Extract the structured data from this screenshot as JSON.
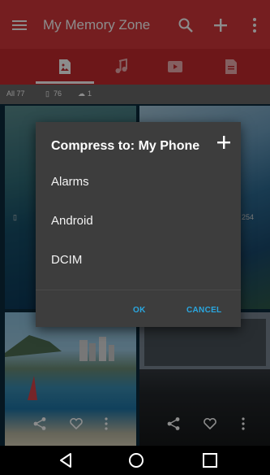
{
  "appbar": {
    "title": "My Memory Zone",
    "color": "#d6373b"
  },
  "icons": {
    "menu": "hamburger-menu-icon",
    "search": "search-icon",
    "add": "add-icon",
    "more": "more-vert-icon",
    "tab_photos": "photo-file-icon",
    "tab_music": "music-note-icon",
    "tab_video": "video-icon",
    "tab_docs": "document-icon",
    "share": "share-icon",
    "favorite": "heart-icon",
    "back": "back-icon",
    "home": "home-icon",
    "recents": "recents-icon"
  },
  "counts": {
    "all": "All 77",
    "device": "76",
    "cloud": "1"
  },
  "grid": {
    "caption_right": "254"
  },
  "dialog": {
    "title": "Compress to: My Phone",
    "items": [
      "Alarms",
      "Android",
      "DCIM"
    ],
    "ok_label": "OK",
    "cancel_label": "CANCEL",
    "accent_color": "#2aa7e0"
  }
}
